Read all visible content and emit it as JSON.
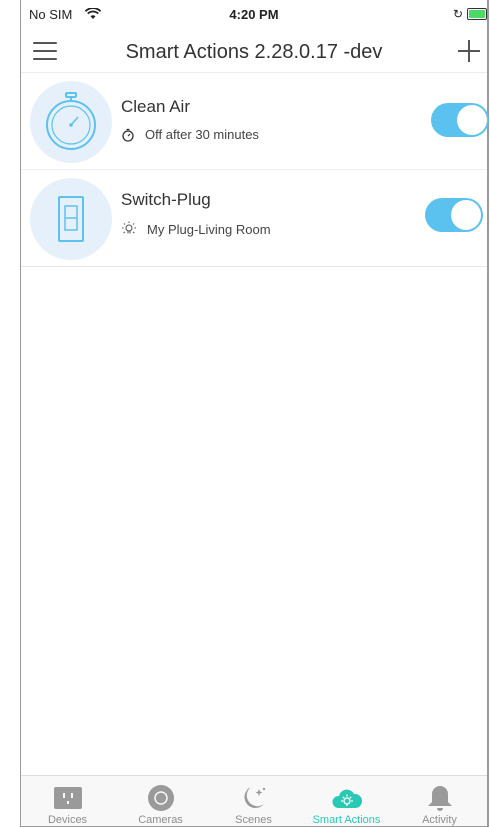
{
  "status_bar": {
    "carrier": "No SIM",
    "time": "4:20 PM"
  },
  "header": {
    "title": "Smart Actions 2.28.0.17 -dev"
  },
  "actions": [
    {
      "name": "Clean Air",
      "detail": "Off after 30 minutes",
      "icon": "timer-icon",
      "enabled": true
    },
    {
      "name": "Switch-Plug",
      "detail": "My Plug-Living Room",
      "icon": "light-switch-icon",
      "enabled": true
    }
  ],
  "tabs": [
    {
      "label": "Devices",
      "icon": "outlet-icon",
      "active": false
    },
    {
      "label": "Cameras",
      "icon": "camera-lens-icon",
      "active": false
    },
    {
      "label": "Scenes",
      "icon": "moon-stars-icon",
      "active": false
    },
    {
      "label": "Smart Actions",
      "icon": "cloud-sun-icon",
      "active": true
    },
    {
      "label": "Activity",
      "icon": "bell-icon",
      "active": false
    }
  ],
  "colors": {
    "accent": "#5bc2ef",
    "active_tab": "#29c9b6",
    "inactive_icon": "#9a9a9a",
    "icon_bg": "#e6f0fa"
  }
}
